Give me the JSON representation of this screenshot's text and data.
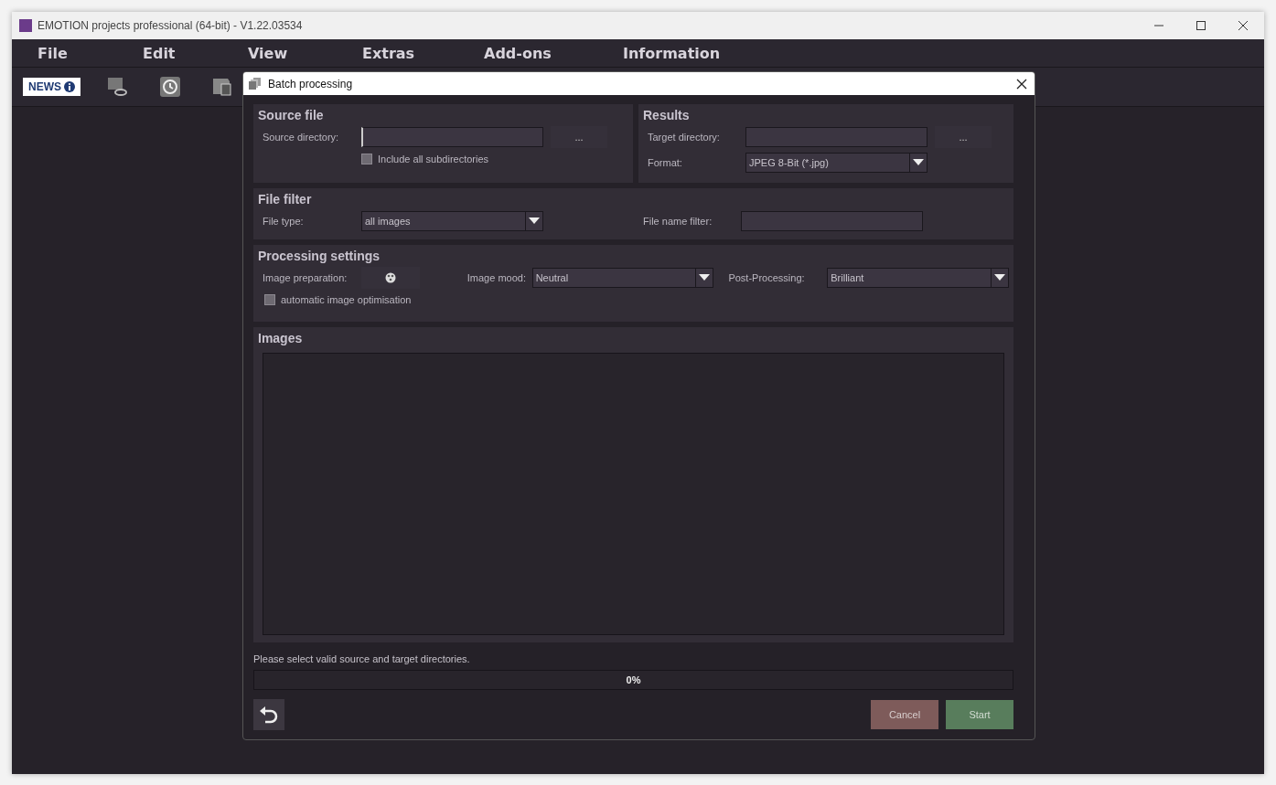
{
  "window": {
    "title": "EMOTION projects professional (64-bit) - V1.22.03534"
  },
  "menu": [
    "File",
    "Edit",
    "View",
    "Extras",
    "Add-ons",
    "Information"
  ],
  "toolbar": {
    "news_badge": "NEWS"
  },
  "dialog": {
    "title": "Batch processing",
    "source": {
      "heading": "Source file",
      "directory_label": "Source directory:",
      "browse": "...",
      "include_sub": {
        "label": "Include all subdirectories",
        "checked": false
      }
    },
    "results": {
      "heading": "Results",
      "directory_label": "Target directory:",
      "browse": "...",
      "format_label": "Format:",
      "format": "JPEG 8-Bit (*.jpg)"
    },
    "filter": {
      "heading": "File filter",
      "type_label": "File type:",
      "type": "all images",
      "name_label": "File name filter:"
    },
    "processing": {
      "heading": "Processing settings",
      "preparation_label": "Image preparation:",
      "mood_label": "Image mood:",
      "mood": "Neutral",
      "post_label": "Post-Processing:",
      "post": "Brilliant",
      "auto_opt": {
        "label": "automatic image optimisation",
        "checked": false
      }
    },
    "images": {
      "heading": "Images"
    },
    "status": "Please select valid source and target directories.",
    "progress": {
      "level": 0,
      "reading": "0%"
    },
    "buttons": {
      "cancel": "Cancel",
      "start": "Start"
    }
  }
}
